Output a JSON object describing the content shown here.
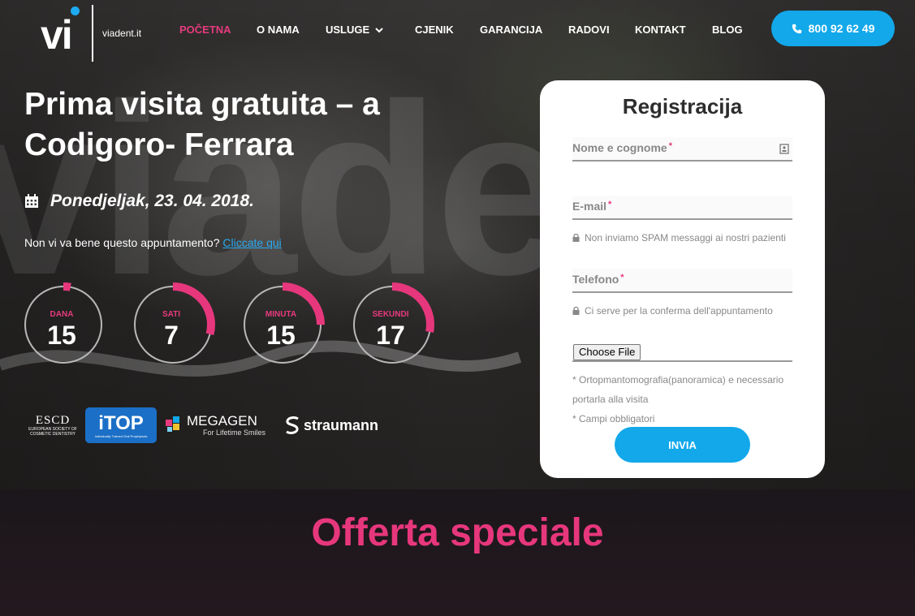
{
  "header": {
    "logo_mark": "vi",
    "logo_text": "viadent.it",
    "nav": [
      {
        "label": "POČETNA",
        "active": true
      },
      {
        "label": "O NAMA",
        "active": false
      },
      {
        "label": "USLUGE",
        "active": false,
        "dropdown": true
      },
      {
        "label": "CJENIK",
        "active": false
      },
      {
        "label": "GARANCIJA",
        "active": false
      },
      {
        "label": "RADOVI",
        "active": false
      },
      {
        "label": "KONTAKT",
        "active": false
      },
      {
        "label": "BLOG",
        "active": false
      }
    ],
    "phone": "800 92 62 49"
  },
  "hero": {
    "title_line1": "Prima visita gratuita – a",
    "title_line2": "Codigoro- Ferrara",
    "date": "Ponedjeljak, 23. 04. 2018.",
    "reschedule_text": "Non vi va bene questo appuntamento?",
    "reschedule_link": "Cliccate qui",
    "watermark": "viadent"
  },
  "countdown": [
    {
      "label": "DANA",
      "value": "15",
      "progress": 0.03
    },
    {
      "label": "SATI",
      "value": "7",
      "progress": 0.29
    },
    {
      "label": "MINUTA",
      "value": "15",
      "progress": 0.25
    },
    {
      "label": "SEKUNDI",
      "value": "17",
      "progress": 0.28
    }
  ],
  "partners": {
    "escd": {
      "name": "ESCD",
      "sub": "EUROPEAN SOCIETY OF COSMETIC DENTISTRY"
    },
    "itop": {
      "name": "iTOP",
      "sub": "Individually Trained Oral Prophylaxis"
    },
    "megagen": {
      "name": "MEGAGEN",
      "sub": "For Lifetime Smiles"
    },
    "straumann": {
      "name": "straumann"
    }
  },
  "form": {
    "title": "Registracija",
    "name_label": "Nome e cognome",
    "email_label": "E-mail",
    "email_hint": "Non inviamo SPAM messaggi ai nostri pazienti",
    "phone_label": "Telefono",
    "phone_hint": "Ci serve per la conferma dell'appuntamento",
    "file_button": "Choose File",
    "file_note": "* Ortopmantomografia(panoramica) e necessario portarla alla visita",
    "required_note": "* Campi obbligatori",
    "submit": "INVIA",
    "required_mark": "*"
  },
  "offer": {
    "title": "Offerta speciale"
  },
  "colors": {
    "accent_pink": "#e73a7e",
    "accent_blue": "#12a8ea"
  }
}
